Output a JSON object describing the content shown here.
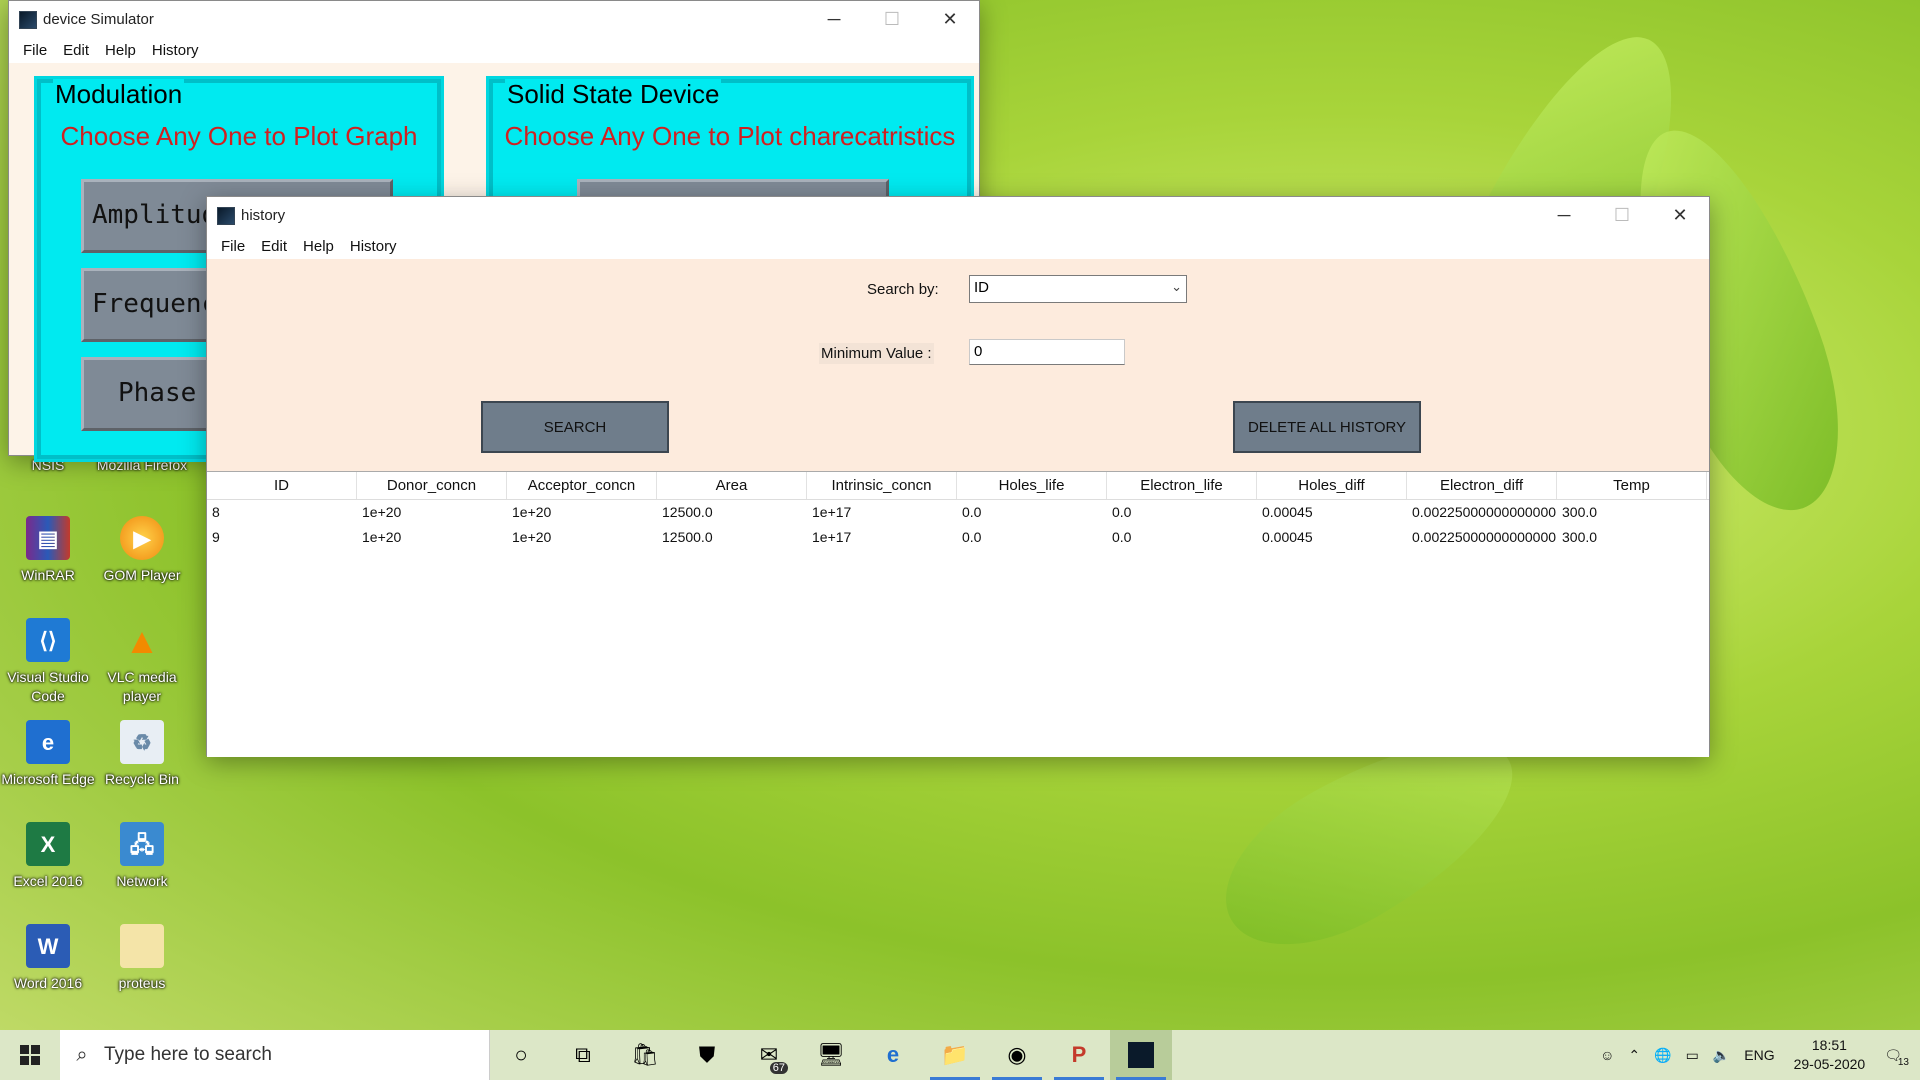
{
  "desktop_icons": [
    {
      "label": "NSIS",
      "icon": "nsis-icon"
    },
    {
      "label": "Mozilla Firefox",
      "icon": "firefox-icon"
    },
    {
      "label": "WinRAR",
      "icon": "winrar-icon"
    },
    {
      "label": "GOM Player",
      "icon": "gom-player-icon"
    },
    {
      "label": "Visual Studio Code",
      "icon": "vscode-icon"
    },
    {
      "label": "VLC media player",
      "icon": "vlc-icon"
    },
    {
      "label": "Microsoft Edge",
      "icon": "edge-icon"
    },
    {
      "label": "Recycle Bin",
      "icon": "recycle-bin-icon"
    },
    {
      "label": "Excel 2016",
      "icon": "excel-icon"
    },
    {
      "label": "Network",
      "icon": "network-icon"
    },
    {
      "label": "Word 2016",
      "icon": "word-icon"
    },
    {
      "label": "proteus",
      "icon": "folder-icon"
    }
  ],
  "simulator": {
    "title": "device Simulator",
    "menu": [
      "File",
      "Edit",
      "Help",
      "History"
    ],
    "modulation": {
      "legend": "Modulation",
      "subtitle": "Choose Any One to Plot Graph",
      "buttons": [
        "Amplitude Modulation",
        "Frequency Modulation",
        "Phase Modulation"
      ]
    },
    "solid_state": {
      "legend": "Solid State Device",
      "subtitle": "Choose Any One to Plot charecatristics"
    }
  },
  "history": {
    "title": "history",
    "menu": [
      "File",
      "Edit",
      "Help",
      "History"
    ],
    "search_by_label": "Search by:",
    "search_by_value": "ID",
    "min_value_label": "Minimum Value :",
    "min_value": "0",
    "search_button": "SEARCH",
    "delete_button": "DELETE ALL HISTORY",
    "columns": [
      "ID",
      "Donor_concn",
      "Acceptor_concn",
      "Area",
      "Intrinsic_concn",
      "Holes_life",
      "Electron_life",
      "Holes_diff",
      "Electron_diff",
      "Temp"
    ],
    "rows": [
      [
        "8",
        "1e+20",
        "1e+20",
        "12500.0",
        "1e+17",
        "0.0",
        "0.0",
        "0.00045",
        "0.00225000000000000",
        "300.0"
      ],
      [
        "9",
        "1e+20",
        "1e+20",
        "12500.0",
        "1e+17",
        "0.0",
        "0.0",
        "0.00045",
        "0.00225000000000000",
        "300.0"
      ]
    ]
  },
  "taskbar": {
    "search_placeholder": "Type here to search",
    "mail_badge": "67",
    "language": "ENG",
    "time": "18:51",
    "date": "29-05-2020",
    "notification_count": "13"
  },
  "colors": {
    "accent_cyan": "#00eaf0",
    "heading_red": "#d02020",
    "button_gray": "#6f7d8b",
    "history_bg": "#fdebdd"
  }
}
